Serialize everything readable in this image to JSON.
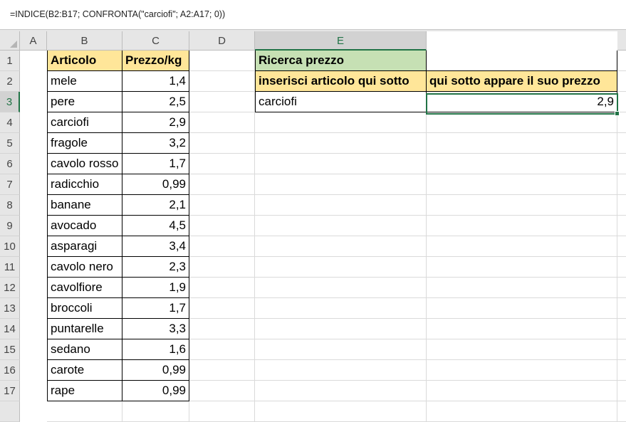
{
  "formula_bar": {
    "text": "=INDICE(B2:B17; CONFRONTA(\"carciofi\"; A2:A17; 0))"
  },
  "columns": [
    "A",
    "B",
    "C",
    "D",
    "E"
  ],
  "selected_column": "E",
  "selected_row": "3",
  "rows": [
    "1",
    "2",
    "3",
    "4",
    "5",
    "6",
    "7",
    "8",
    "9",
    "10",
    "11",
    "12",
    "13",
    "14",
    "15",
    "16",
    "17"
  ],
  "table": {
    "headers": {
      "article": "Articolo",
      "price": "Prezzo/kg"
    },
    "items": [
      {
        "name": "mele",
        "price": "1,4"
      },
      {
        "name": "pere",
        "price": "2,5"
      },
      {
        "name": "carciofi",
        "price": "2,9"
      },
      {
        "name": "fragole",
        "price": "3,2"
      },
      {
        "name": "cavolo rosso",
        "price": "1,7"
      },
      {
        "name": "radicchio",
        "price": "0,99"
      },
      {
        "name": "banane",
        "price": "2,1"
      },
      {
        "name": "avocado",
        "price": "4,5"
      },
      {
        "name": "asparagi",
        "price": "3,4"
      },
      {
        "name": "cavolo nero",
        "price": "2,3"
      },
      {
        "name": "cavolfiore",
        "price": "1,9"
      },
      {
        "name": "broccoli",
        "price": "1,7"
      },
      {
        "name": "puntarelle",
        "price": "3,3"
      },
      {
        "name": "sedano",
        "price": "1,6"
      },
      {
        "name": "carote",
        "price": "0,99"
      },
      {
        "name": "rape",
        "price": "0,99"
      }
    ]
  },
  "lookup": {
    "title": "Ricerca prezzo",
    "input_label": "inserisci articolo qui sotto",
    "output_label": "qui sotto appare il suo prezzo",
    "input_value": "carciofi",
    "output_value": "2,9"
  },
  "colors": {
    "header_fill": "#ffe699",
    "title_fill": "#c6e0b4",
    "selection": "#217346"
  }
}
